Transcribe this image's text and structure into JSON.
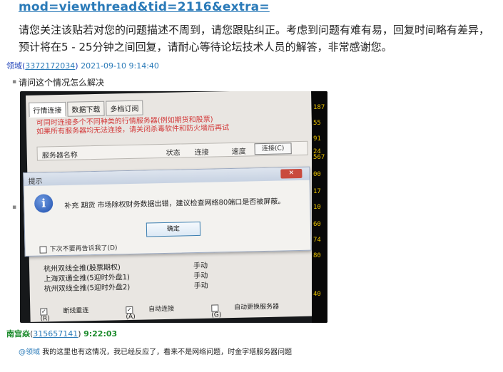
{
  "thread": {
    "link_text": "mod=viewthread&tid=2116&extra=",
    "notice_text": "请您关注该贴若对您的问题描述不周到，请您跟贴纠正。考虑到问题有难有易，回复时间略有差异，预计将在5 - 25分钟之间回复，请耐心等待论坛技术人员的解答，非常感谢您。"
  },
  "post": {
    "author": "领域",
    "author_id": "3372172034",
    "timestamp": "2021-09-10 9:14:40",
    "question": "请问这个情况怎么解决"
  },
  "screenshot": {
    "tabs": [
      "行情连接",
      "数据下载",
      "多档订阅"
    ],
    "red_message_line1": "可同时连接多个不同种类的行情服务器(例如期货和股票)",
    "red_message_line2": "如果所有服务器均无法连接，请关闭杀毒软件和防火墙后再试",
    "server_headers": {
      "name": "服务器名称",
      "status": "状态",
      "connect": "连接",
      "speed": "速度"
    },
    "connect_button": "连接(C)",
    "dialog_title": "提示",
    "dialog_close": "✕",
    "dialog_message": "补充 期货 市场除权财务数据出错，建议检查网络80端口是否被屏蔽。",
    "ok_button": "确定",
    "dont_ask_label": "下次不要再告诉我了(D)",
    "server_rows": [
      {
        "name": "杭州双线全推(股票期权)",
        "mode": "手动"
      },
      {
        "name": "上海双通全推(5迎时外盘1)",
        "mode": "手动"
      },
      {
        "name": "杭州双线全推(5迎时外盘2)",
        "mode": "手动"
      }
    ],
    "bottom_checks": [
      {
        "label": "断线重连(R)",
        "checked": true
      },
      {
        "label": "自动连接(A)",
        "checked": true
      },
      {
        "label": "自动更换服务器(G)",
        "checked": false
      }
    ],
    "side_numbers": [
      "187",
      "55",
      "91",
      "24",
      "567",
      "00",
      "17",
      "10",
      "60",
      "74",
      "80",
      "40"
    ]
  },
  "reply": {
    "author": "南宫焱",
    "author_id": "315657141",
    "time": "9:22:03",
    "mention": "@领域",
    "text": "我的这里也有这情况，我已经反应了，看来不是网络问题，时金字塔服务器问题"
  },
  "colors": {
    "link": "#2a7ab8",
    "reply_name": "#1a8a2a",
    "dialog_red": "#d33a3a"
  }
}
